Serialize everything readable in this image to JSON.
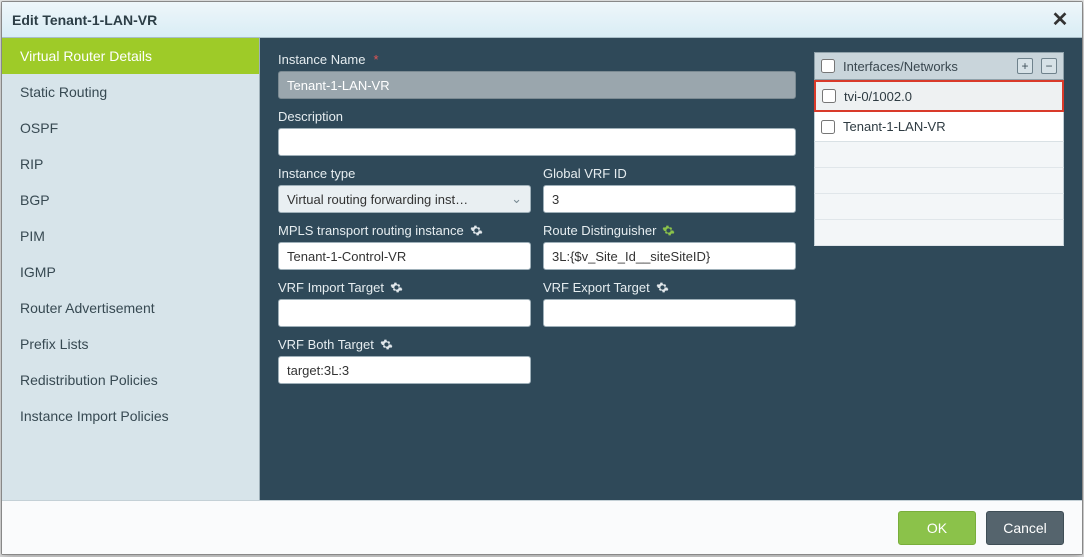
{
  "dialog": {
    "title": "Edit Tenant-1-LAN-VR"
  },
  "sidebar": {
    "tabs": [
      "Virtual Router Details",
      "Static Routing",
      "OSPF",
      "RIP",
      "BGP",
      "PIM",
      "IGMP",
      "Router Advertisement",
      "Prefix Lists",
      "Redistribution Policies",
      "Instance Import Policies"
    ],
    "active_index": 0
  },
  "form": {
    "instance_name_label": "Instance Name",
    "instance_name_value": "Tenant-1-LAN-VR",
    "description_label": "Description",
    "description_value": "",
    "instance_type_label": "Instance type",
    "instance_type_value": "Virtual routing forwarding inst…",
    "global_vrf_id_label": "Global VRF ID",
    "global_vrf_id_value": "3",
    "mpls_label": "MPLS transport routing instance",
    "mpls_value": "Tenant-1-Control-VR",
    "rd_label": "Route Distinguisher",
    "rd_value": "3L:{$v_Site_Id__siteSiteID}",
    "vrf_import_label": "VRF Import Target",
    "vrf_import_value": "",
    "vrf_export_label": "VRF Export Target",
    "vrf_export_value": "",
    "vrf_both_label": "VRF Both Target",
    "vrf_both_value": "target:3L:3"
  },
  "iface": {
    "header": "Interfaces/Networks",
    "rows": [
      {
        "label": "tvi-0/1002.0",
        "highlight": true
      },
      {
        "label": "Tenant-1-LAN-VR",
        "highlight": false
      }
    ]
  },
  "footer": {
    "ok": "OK",
    "cancel": "Cancel"
  },
  "icons": {
    "close": "✕",
    "plus": "+",
    "minus": "−",
    "chev": "⌄"
  }
}
